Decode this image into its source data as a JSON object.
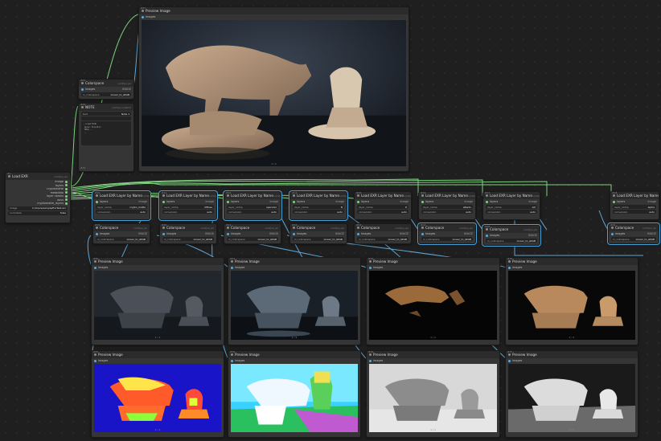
{
  "colors": {
    "wire_green": "#7fd17f",
    "wire_blue": "#5fa7d6",
    "wire_teal": "#6fc9b6",
    "accent": "#4aa3d8"
  },
  "top_preview": {
    "badge": "#27",
    "title": "Preview Image",
    "input": "images",
    "id": "",
    "caption": "1 / 1"
  },
  "colorspace_top": {
    "badge": "#25",
    "title": "Colorspace",
    "id": "comfyui_ex",
    "input": "images",
    "output": "IMAGE",
    "w1_label": "in_colorspace",
    "w1_value": "Linear_to_sRGB"
  },
  "note_node": {
    "badge": "#26",
    "title": "NOTE",
    "id": "comfyui-custom",
    "w1_label": "text",
    "w1_value": "Note 1",
    "w2_label": "",
    "w2_value": "",
    "text": "... Load EXR\n  layer: 'R,G,B,A'\n  filter ...\n  ...",
    "badge2": "#12"
  },
  "load_exr": {
    "badge": "#1",
    "title": "Load EXR",
    "id": "comfyui_ex",
    "outputs": [
      "image",
      "layers",
      "cryptomatte",
      "metadata",
      "layer names",
      "aovs",
      "cryptomatte_layers"
    ],
    "w_label": "image",
    "w_value": "C:/Users/sample/ExrTest.exr",
    "w2_label": "normalize",
    "w2_value": "false"
  },
  "layer_nodes": [
    {
      "badge": "#10",
      "title": "Load EXR Layer by Name",
      "id": "comfyui_ex",
      "in": "layers",
      "out": "image",
      "w1": "layer_name",
      "v1": "crypto_matte",
      "w2": "conversion",
      "v2": "auto"
    },
    {
      "badge": "#11",
      "title": "Load EXR Layer by Name",
      "id": "comfyui_ex",
      "in": "layers",
      "out": "image",
      "w1": "layer_name",
      "v1": "diffuse",
      "w2": "conversion",
      "v2": "auto"
    },
    {
      "badge": "#13",
      "title": "Load EXR Layer by Name",
      "id": "comfyui_ex",
      "in": "layers",
      "out": "image",
      "w1": "layer_name",
      "v1": "specular",
      "w2": "conversion",
      "v2": "auto"
    },
    {
      "badge": "#14",
      "title": "Load EXR Layer by Name",
      "id": "comfyui_ex",
      "in": "layers",
      "out": "image",
      "w1": "layer_name",
      "v1": "N",
      "w2": "conversion",
      "v2": "auto"
    },
    {
      "badge": "#15",
      "title": "Load EXR Layer by Name",
      "id": "comfyui_ex",
      "in": "layers",
      "out": "image",
      "w1": "layer_name",
      "v1": "Z",
      "w2": "conversion",
      "v2": "auto"
    },
    {
      "badge": "#16",
      "title": "Load EXR Layer by Name",
      "id": "comfyui_ex",
      "in": "layers",
      "out": "image",
      "w1": "layer_name",
      "v1": "albedo",
      "w2": "conversion",
      "v2": "auto"
    },
    {
      "badge": "#17",
      "title": "Load EXR Layer by Name",
      "id": "comfyui_ex",
      "in": "layers",
      "out": "image",
      "w1": "layer_name",
      "v1": "AO",
      "w2": "conversion",
      "v2": "auto"
    },
    {
      "badge": "#18",
      "title": "Load EXR Layer by Name",
      "id": "comfyui_ex",
      "in": "layers",
      "out": "image",
      "w1": "layer_name",
      "v1": "alpha",
      "w2": "conversion",
      "v2": "auto"
    }
  ],
  "colorspace_nodes": [
    {
      "badge": "#19",
      "title": "Colorspace",
      "id": "comfyui_ex",
      "in": "images",
      "out": "IMAGE",
      "w": "in_colorspace",
      "v": "Linear_to_sRGB"
    },
    {
      "badge": "#20",
      "title": "Colorspace",
      "id": "comfyui_ex",
      "in": "images",
      "out": "IMAGE",
      "w": "in_colorspace",
      "v": "Linear_to_sRGB"
    },
    {
      "badge": "#21",
      "title": "Colorspace",
      "id": "comfyui_ex",
      "in": "images",
      "out": "IMAGE",
      "w": "in_colorspace",
      "v": "Linear_to_sRGB"
    },
    {
      "badge": "#22",
      "title": "Colorspace",
      "id": "comfyui_ex",
      "in": "images",
      "out": "IMAGE",
      "w": "in_colorspace",
      "v": "Linear_to_sRGB"
    },
    {
      "badge": "#23",
      "title": "Colorspace",
      "id": "comfyui_ex",
      "in": "images",
      "out": "IMAGE",
      "w": "in_colorspace",
      "v": "Linear_to_sRGB"
    },
    {
      "badge": "#24",
      "title": "Colorspace",
      "id": "comfyui_ex",
      "in": "images",
      "out": "IMAGE",
      "w": "in_colorspace",
      "v": "Linear_to_sRGB"
    },
    {
      "badge": "#28",
      "title": "Colorspace",
      "id": "comfyui_ex",
      "in": "images",
      "out": "IMAGE",
      "w": "in_colorspace",
      "v": "Linear_to_sRGB"
    },
    {
      "badge": "#29",
      "title": "Colorspace",
      "id": "comfyui_ex",
      "in": "images",
      "out": "IMAGE",
      "w": "in_colorspace",
      "v": "Linear_to_sRGB"
    }
  ],
  "preview_nodes": [
    {
      "badge": "#30",
      "title": "Preview Image",
      "input": "images",
      "caption": "1 / 1"
    },
    {
      "badge": "#31",
      "title": "Preview Image",
      "input": "images",
      "caption": "1 / 1"
    },
    {
      "badge": "#32",
      "title": "Preview Image",
      "input": "images",
      "caption": "1 / 1"
    },
    {
      "badge": "#33",
      "title": "Preview Image",
      "input": "images",
      "caption": "1 / 1"
    },
    {
      "badge": "#34",
      "title": "Preview Image",
      "input": "images",
      "caption": "1 / 1"
    },
    {
      "badge": "#35",
      "title": "Preview Image",
      "input": "images",
      "caption": "1 / 1"
    },
    {
      "badge": "#36",
      "title": "Preview Image",
      "input": "images",
      "caption": "1 / 1"
    },
    {
      "badge": "#37",
      "title": "Preview Image",
      "input": "images",
      "caption": "1 / 1"
    }
  ]
}
